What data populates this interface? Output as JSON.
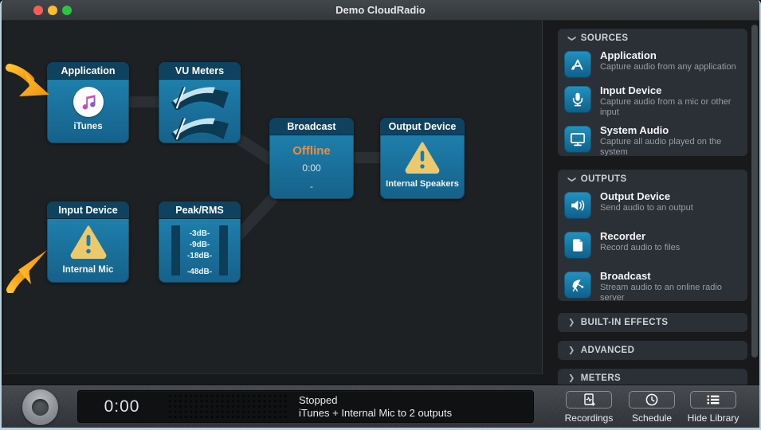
{
  "window": {
    "title": "Demo CloudRadio"
  },
  "canvas": {
    "nodes": {
      "application": {
        "title": "Application",
        "label": "iTunes"
      },
      "vu_meters": {
        "title": "VU Meters"
      },
      "input_device": {
        "title": "Input Device",
        "label": "Internal Mic"
      },
      "peak_rms": {
        "title": "Peak/RMS",
        "scale": [
          "-3dB-",
          "-9dB-",
          "-18dB-",
          "-48dB-"
        ]
      },
      "broadcast": {
        "title": "Broadcast",
        "status": "Offline",
        "time": "0:00",
        "detail": "-"
      },
      "output_device": {
        "title": "Output Device",
        "label": "Internal Speakers"
      }
    }
  },
  "sidebar": {
    "sources": {
      "header": "SOURCES",
      "items": [
        {
          "title": "Application",
          "desc": "Capture audio from any application",
          "icon": "app-store-icon"
        },
        {
          "title": "Input Device",
          "desc": "Capture audio from a mic or other input",
          "icon": "microphone-icon"
        },
        {
          "title": "System Audio",
          "desc": "Capture all audio played on the system",
          "icon": "display-icon"
        }
      ]
    },
    "outputs": {
      "header": "OUTPUTS",
      "items": [
        {
          "title": "Output Device",
          "desc": "Send audio to an output",
          "icon": "speaker-icon"
        },
        {
          "title": "Recorder",
          "desc": "Record audio to files",
          "icon": "file-icon"
        },
        {
          "title": "Broadcast",
          "desc": "Stream audio to an online radio server",
          "icon": "satellite-dish-icon"
        }
      ]
    },
    "collapsed": [
      {
        "label": "BUILT-IN EFFECTS"
      },
      {
        "label": "ADVANCED"
      },
      {
        "label": "METERS"
      }
    ]
  },
  "footer": {
    "timer": "0:00",
    "status_line1": "Stopped",
    "status_line2": "iTunes + Internal Mic to 2 outputs",
    "buttons": [
      {
        "label": "Recordings",
        "icon": "recordings-icon"
      },
      {
        "label": "Schedule",
        "icon": "clock-icon"
      },
      {
        "label": "Hide Library",
        "icon": "list-icon"
      }
    ]
  },
  "colors": {
    "node_teal": "#1d7fae",
    "node_header": "#0e425e",
    "offline_orange": "#ee8d3e",
    "warning_yellow": "#edc96e",
    "arrow_orange": "#f7a81d",
    "canvas_bg": "#1e2124",
    "card_bg": "#2b3036"
  }
}
